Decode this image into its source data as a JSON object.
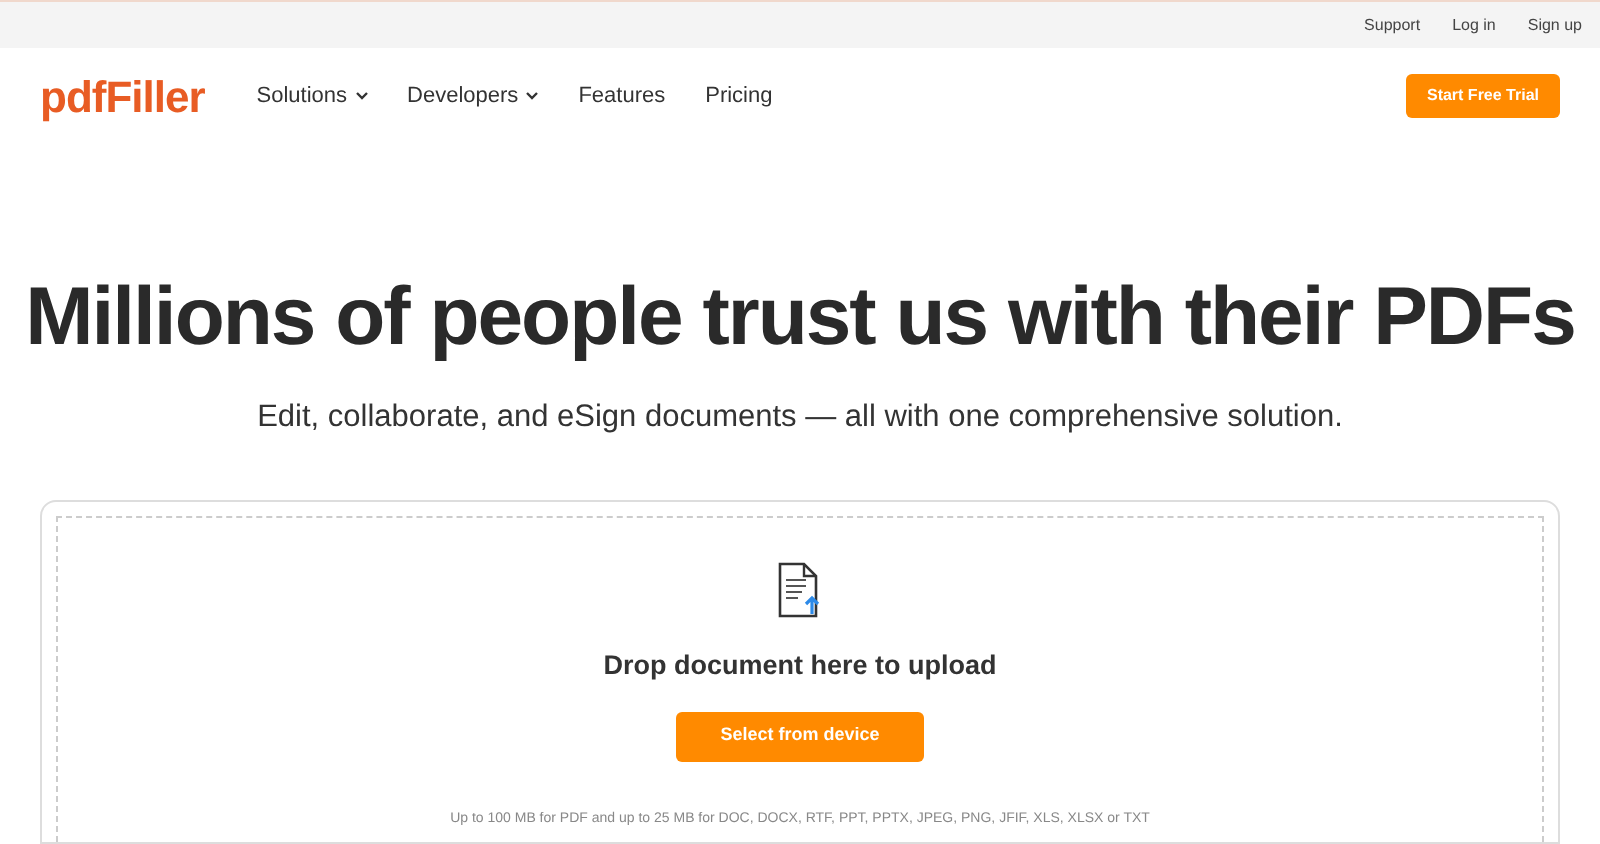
{
  "top_links": [
    "Support",
    "Log in",
    "Sign up"
  ],
  "logo": "pdfFiller",
  "nav": [
    {
      "label": "Solutions",
      "dropdown": true
    },
    {
      "label": "Developers",
      "dropdown": true
    },
    {
      "label": "Features",
      "dropdown": false
    },
    {
      "label": "Pricing",
      "dropdown": false
    }
  ],
  "cta": "Start Free Trial",
  "headline": "Millions of people trust us with their PDFs",
  "subtitle": "Edit, collaborate, and eSign documents — all with one comprehensive solution.",
  "upload": {
    "title": "Drop document here to upload",
    "button": "Select from device",
    "note": "Up to 100 MB for PDF and up to 25 MB for DOC, DOCX, RTF, PPT, PPTX, JPEG, PNG, JFIF, XLS, XLSX or TXT"
  }
}
